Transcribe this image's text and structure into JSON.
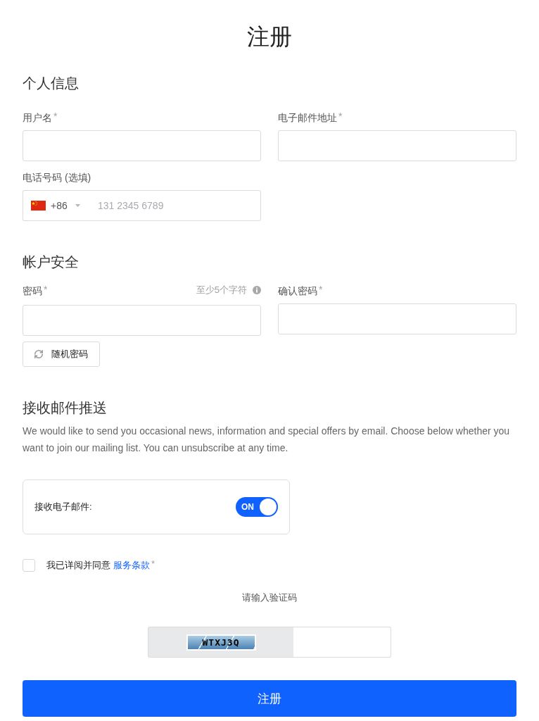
{
  "title": "注册",
  "personal": {
    "heading": "个人信息",
    "username": {
      "label": "用户名",
      "mark": "*"
    },
    "email": {
      "label": "电子邮件地址",
      "mark": "*"
    },
    "phone": {
      "label": "电话号码 (选填)",
      "country_code": "+86",
      "placeholder": "131 2345 6789"
    }
  },
  "security": {
    "heading": "帐户安全",
    "password": {
      "label": "密码",
      "mark": "*",
      "hint": "至少5个字符"
    },
    "confirm_password": {
      "label": "确认密码",
      "mark": "*"
    },
    "random_password_button": "随机密码"
  },
  "mailing": {
    "heading": "接收邮件推送",
    "description": "We would like to send you occasional news, information and special offers by email. Choose below whether you want to join our mailing list. You can unsubscribe at any time.",
    "toggle": {
      "label": "接收电子邮件:",
      "on": true,
      "state_text": "ON"
    }
  },
  "terms": {
    "checked": false,
    "text": "我已详阅并同意",
    "link": "服务条款",
    "mark": "*"
  },
  "captcha": {
    "prompt": "请输入验证码",
    "code": "WTXJ3Q"
  },
  "submit_button": "注册"
}
